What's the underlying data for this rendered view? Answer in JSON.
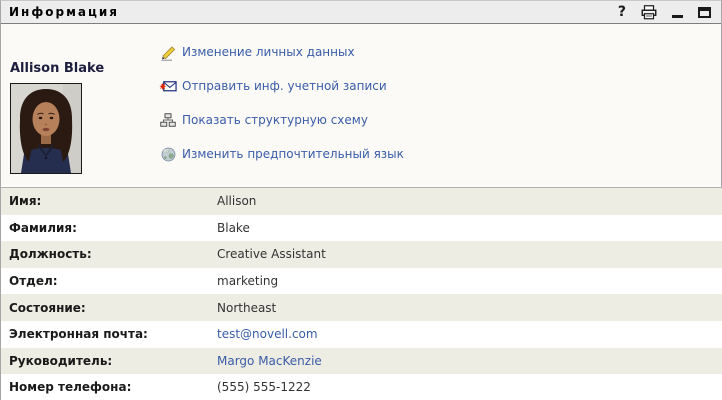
{
  "titlebar": {
    "title": "Информация",
    "help_glyph": "?"
  },
  "profile": {
    "name": "Allison Blake"
  },
  "actions": [
    {
      "icon": "edit-pencil-icon",
      "label": "Изменение личных данных"
    },
    {
      "icon": "send-mail-icon",
      "label": "Отправить инф. учетной записи"
    },
    {
      "icon": "org-chart-icon",
      "label": "Показать структурную схему"
    },
    {
      "icon": "globe-icon",
      "label": "Изменить предпочтительный язык"
    }
  ],
  "details": {
    "rows": [
      {
        "label": "Имя:",
        "value": "Allison"
      },
      {
        "label": "Фамилия:",
        "value": "Blake"
      },
      {
        "label": "Должность:",
        "value": "Creative Assistant"
      },
      {
        "label": "Отдел:",
        "value": "marketing"
      },
      {
        "label": "Состояние:",
        "value": "Northeast"
      },
      {
        "label": "Электронная почта:",
        "value": "test@novell.com"
      },
      {
        "label": "Руководитель:",
        "value": "Margo MacKenzie"
      },
      {
        "label": "Номер телефона:",
        "value": "(555) 555-1222"
      }
    ]
  },
  "colors": {
    "link_blue": "#3a5da8",
    "stripe": "#eeede3",
    "titlebar_bg": "#ededed",
    "top_section_bg": "#fbfaf7"
  }
}
